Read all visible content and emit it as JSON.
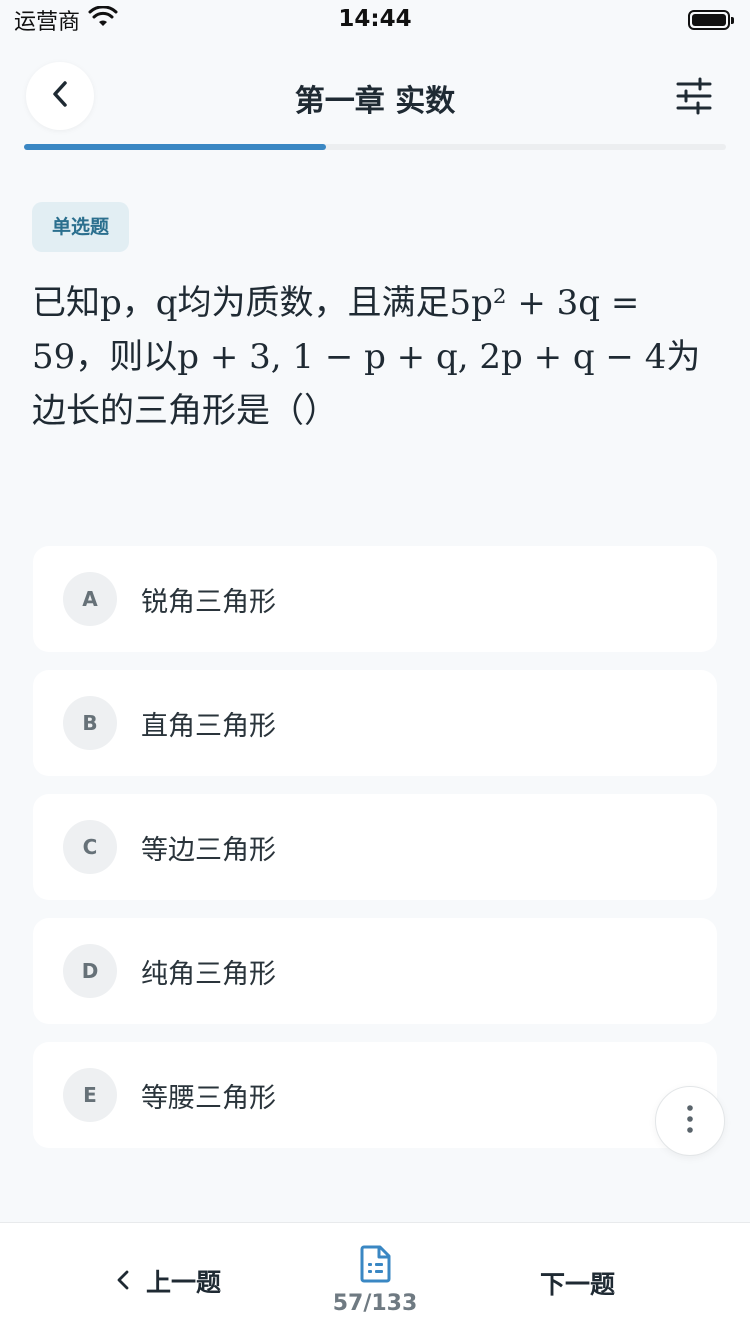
{
  "status_bar": {
    "carrier": "运营商",
    "time": "14:44"
  },
  "header": {
    "title": "第一章 实数"
  },
  "progress": {
    "fraction": 0.43
  },
  "question": {
    "type_label": "单选题",
    "text": "已知p，q均为质数，且满足5p² + 3q = 59，则以p + 3, 1 − p + q, 2p + q − 4为边长的三角形是（）"
  },
  "options": [
    {
      "letter": "A",
      "text": "锐角三角形"
    },
    {
      "letter": "B",
      "text": "直角三角形"
    },
    {
      "letter": "C",
      "text": "等边三角形"
    },
    {
      "letter": "D",
      "text": "纯角三角形"
    },
    {
      "letter": "E",
      "text": "等腰三角形"
    }
  ],
  "bottom_bar": {
    "prev_label": "上一题",
    "counter": "57/133",
    "next_label": "下一题"
  },
  "icons": {
    "back": "chevron-left-icon",
    "settings": "sliders-icon",
    "more": "more-vertical-icon",
    "answer_sheet": "document-list-icon"
  },
  "colors": {
    "accent": "#3a87c3",
    "badge_bg": "#e2eef3",
    "badge_text": "#2b6f8e"
  }
}
